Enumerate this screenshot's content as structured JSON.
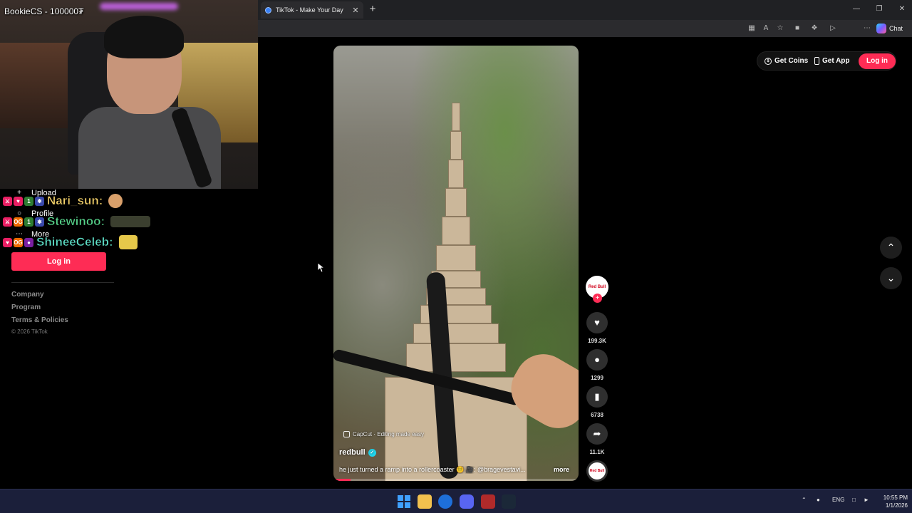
{
  "stream": {
    "title": "BookieCS - 100000₮"
  },
  "browser": {
    "tab_title": "TikTok - Make Your Day",
    "tab_close": "✕",
    "new_tab": "+",
    "chat_label": "Chat"
  },
  "sidebar": {
    "nav": [
      {
        "icon": "+",
        "label": "Upload"
      },
      {
        "icon": "○",
        "label": "Profile"
      },
      {
        "icon": "⋯",
        "label": "More"
      }
    ],
    "login_label": "Log in",
    "footer": [
      "Company",
      "Program",
      "Terms & Policies"
    ],
    "copyright": "© 2026 TikTok"
  },
  "chat": [
    {
      "name": "Nari_sun:",
      "color": "#f5d36b",
      "badge": "1"
    },
    {
      "name": "Stewinoo:",
      "color": "#58d68d",
      "badge": "1"
    },
    {
      "name": "ShineeCeleb:",
      "color": "#5ee0c8",
      "badge": "OG"
    }
  ],
  "video": {
    "capcut_label": "CapCut · Editing made easy",
    "author": "redbull",
    "description": "he just turned a ramp into a rollercoaster 😵‍💫 🎥: @bragevestavi...",
    "more_label": "more",
    "progress": 0.07
  },
  "actions": {
    "avatar_text": "Red Bull",
    "likes": "199.3K",
    "comments": "1299",
    "saves": "6738",
    "shares": "11.1K"
  },
  "header": {
    "get_coins": "Get Coins",
    "get_app": "Get App",
    "login": "Log in"
  },
  "taskbar": {
    "lang": "ENG",
    "time": "10:55 PM",
    "date": "1/1/2026"
  },
  "colors": {
    "tiktok_red": "#fe2c55",
    "verified": "#20d5ec",
    "taskbar": "#1b1f3a"
  }
}
